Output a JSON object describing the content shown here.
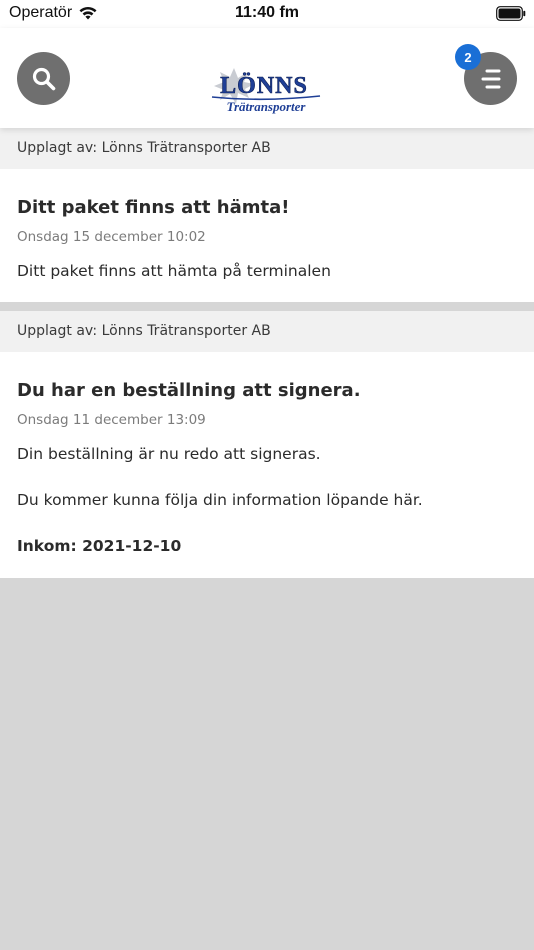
{
  "status_bar": {
    "carrier": "Operatör",
    "time": "11:40 fm"
  },
  "header": {
    "logo_text": "LÖNNS",
    "logo_subtext": "Trätransporter",
    "notification_count": "2",
    "icons": [
      "search-icon",
      "menu-icon"
    ]
  },
  "posts": [
    {
      "posted_by": "Upplagt av: Lönns Trätransporter AB",
      "title": "Ditt paket finns att hämta!",
      "date": "Onsdag 15 december 10:02",
      "body": "Ditt paket finns att hämta på terminalen"
    },
    {
      "posted_by": "Upplagt av: Lönns Trätransporter AB",
      "title": "Du har en beställning att signera.",
      "date": "Onsdag 11 december 13:09",
      "body": "Din beställning är nu redo att signeras.",
      "body_2": "Du kommer kunna följa din information löpande här.",
      "inkom": "Inkom: 2021-12-10"
    }
  ],
  "colors": {
    "button_bg": "#6f6f6f",
    "badge_bg": "#1a6fd6",
    "logo_blue": "#1f3f96",
    "background": "#d6d6d6"
  }
}
